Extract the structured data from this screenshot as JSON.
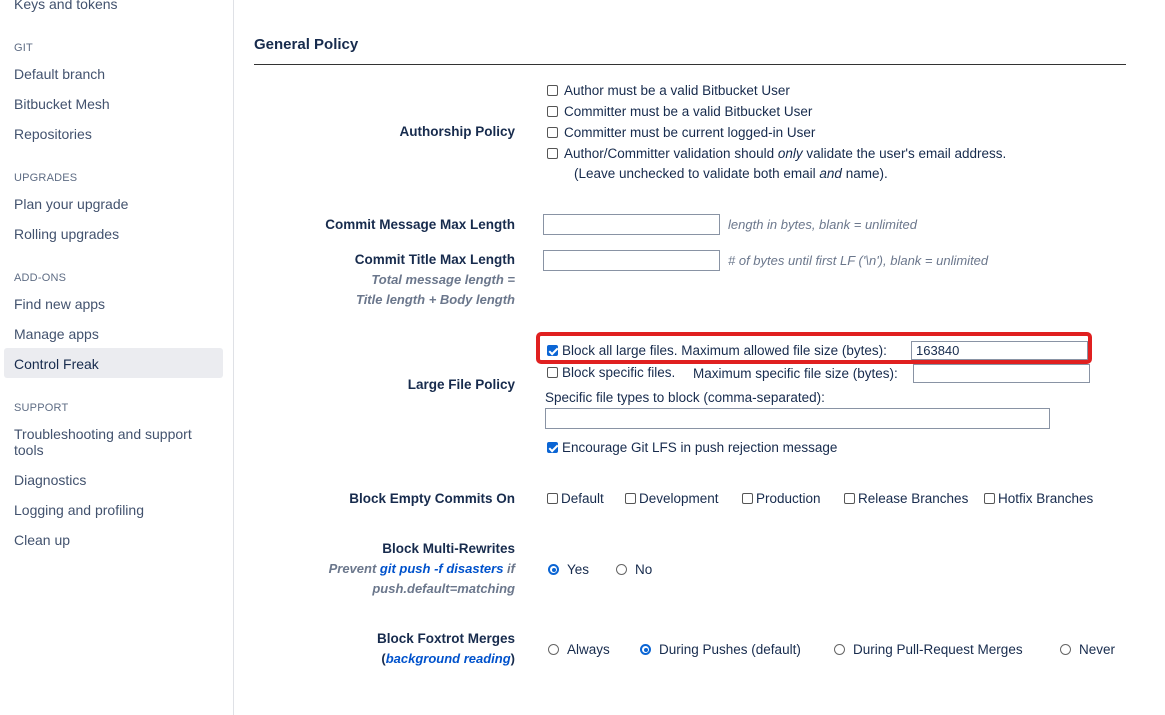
{
  "sidebar": {
    "top_item": "Keys and tokens",
    "sections": [
      {
        "heading": "GIT",
        "items": [
          "Default branch",
          "Bitbucket Mesh",
          "Repositories"
        ]
      },
      {
        "heading": "UPGRADES",
        "items": [
          "Plan your upgrade",
          "Rolling upgrades"
        ]
      },
      {
        "heading": "ADD-ONS",
        "items": [
          "Find new apps",
          "Manage apps",
          "Control Freak"
        ]
      },
      {
        "heading": "SUPPORT",
        "items": [
          "Troubleshooting and support tools",
          "Diagnostics",
          "Logging and profiling",
          "Clean up"
        ]
      }
    ],
    "active_item": "Control Freak"
  },
  "main": {
    "title": "General Policy",
    "authorship": {
      "label": "Authorship Policy",
      "options": [
        {
          "label": "Author must be a valid Bitbucket User",
          "checked": false
        },
        {
          "label": "Committer must be a valid Bitbucket User",
          "checked": false
        },
        {
          "label": "Committer must be current logged-in User",
          "checked": false
        }
      ],
      "email_only": {
        "prefix": "Author/Committer validation should ",
        "emph": "only",
        "suffix": " validate the user's email address.",
        "note_prefix": "(Leave unchecked to validate both email ",
        "note_emph": "and",
        "note_suffix": " name).",
        "checked": false
      }
    },
    "commit_message_max": {
      "label": "Commit Message Max Length",
      "value": "",
      "hint": "length in bytes, blank = unlimited"
    },
    "commit_title_max": {
      "label": "Commit Title Max Length",
      "value": "",
      "hint": "# of bytes until first LF ('\\n'), blank = unlimited",
      "sub1": "Total message length =",
      "sub2": "Title length + Body length"
    },
    "large_file": {
      "label": "Large File Policy",
      "block_all_label": "Block all large files. Maximum allowed file size (bytes):",
      "block_all_checked": true,
      "block_all_value": "163840",
      "block_specific_label": "Block specific files.",
      "block_specific_size_label": "Maximum specific file size (bytes):",
      "block_specific_checked": false,
      "block_specific_value": "",
      "file_types_label": "Specific file types to block (comma-separated):",
      "file_types_value": "",
      "lfs_label": "Encourage Git LFS in push rejection message",
      "lfs_checked": true
    },
    "empty_commits": {
      "label": "Block Empty Commits On",
      "options": [
        {
          "label": "Default",
          "checked": false
        },
        {
          "label": "Development",
          "checked": false
        },
        {
          "label": "Production",
          "checked": false
        },
        {
          "label": "Release Branches",
          "checked": false
        },
        {
          "label": "Hotfix Branches",
          "checked": false
        }
      ]
    },
    "multi_rewrites": {
      "label": "Block Multi-Rewrites",
      "sub_prefix": "Prevent ",
      "sub_link": "git push -f disasters",
      "sub_suffix": " if",
      "sub2": "push.default=matching",
      "options": [
        {
          "label": "Yes",
          "selected": true
        },
        {
          "label": "No",
          "selected": false
        }
      ]
    },
    "foxtrot": {
      "label": "Block Foxtrot Merges",
      "sub_open": "(",
      "sub_link": "background reading",
      "sub_close": ")",
      "options": [
        {
          "label": "Always",
          "selected": false
        },
        {
          "label": "During Pushes (default)",
          "selected": true
        },
        {
          "label": "During Pull-Request Merges",
          "selected": false
        },
        {
          "label": "Never",
          "selected": false
        }
      ]
    },
    "highlight_color": "#e02020",
    "accent_color": "#0b65d4"
  }
}
